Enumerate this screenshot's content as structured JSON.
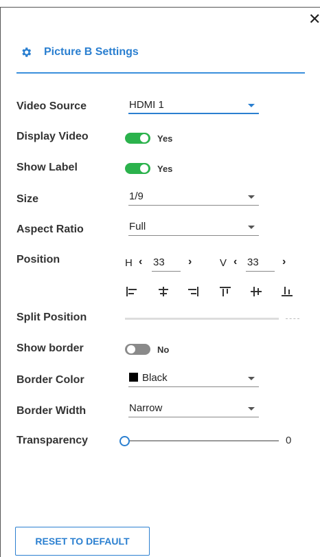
{
  "panel": {
    "title": "Picture B Settings",
    "close_icon": "close-icon",
    "header_icon": "gear-icon",
    "accent_color": "#2a7fd0"
  },
  "fields": {
    "video_source": {
      "label": "Video Source",
      "value": "HDMI 1"
    },
    "display_video": {
      "label": "Display Video",
      "state": "on",
      "text": "Yes"
    },
    "show_label": {
      "label": "Show Label",
      "state": "on",
      "text": "Yes"
    },
    "size": {
      "label": "Size",
      "value": "1/9"
    },
    "aspect_ratio": {
      "label": "Aspect Ratio",
      "value": "Full"
    },
    "position": {
      "label": "Position",
      "h_letter": "H",
      "h_value": "33",
      "v_letter": "V",
      "v_value": "33",
      "align_icons": [
        "align-left-icon",
        "align-center-h-icon",
        "align-right-icon",
        "align-top-icon",
        "align-middle-v-icon",
        "align-bottom-icon"
      ]
    },
    "split_position": {
      "label": "Split Position",
      "value_text": "----"
    },
    "show_border": {
      "label": "Show border",
      "state": "off",
      "text": "No"
    },
    "border_color": {
      "label": "Border Color",
      "value": "Black",
      "swatch_color": "#000000"
    },
    "border_width": {
      "label": "Border Width",
      "value": "Narrow"
    },
    "transparency": {
      "label": "Transparency",
      "value": "0",
      "fraction": 0
    }
  },
  "footer": {
    "reset_label": "RESET TO DEFAULT"
  },
  "colors": {
    "toggle_on": "#2bb24c",
    "toggle_off": "#8a8a8a",
    "accent": "#2a7fd0"
  }
}
